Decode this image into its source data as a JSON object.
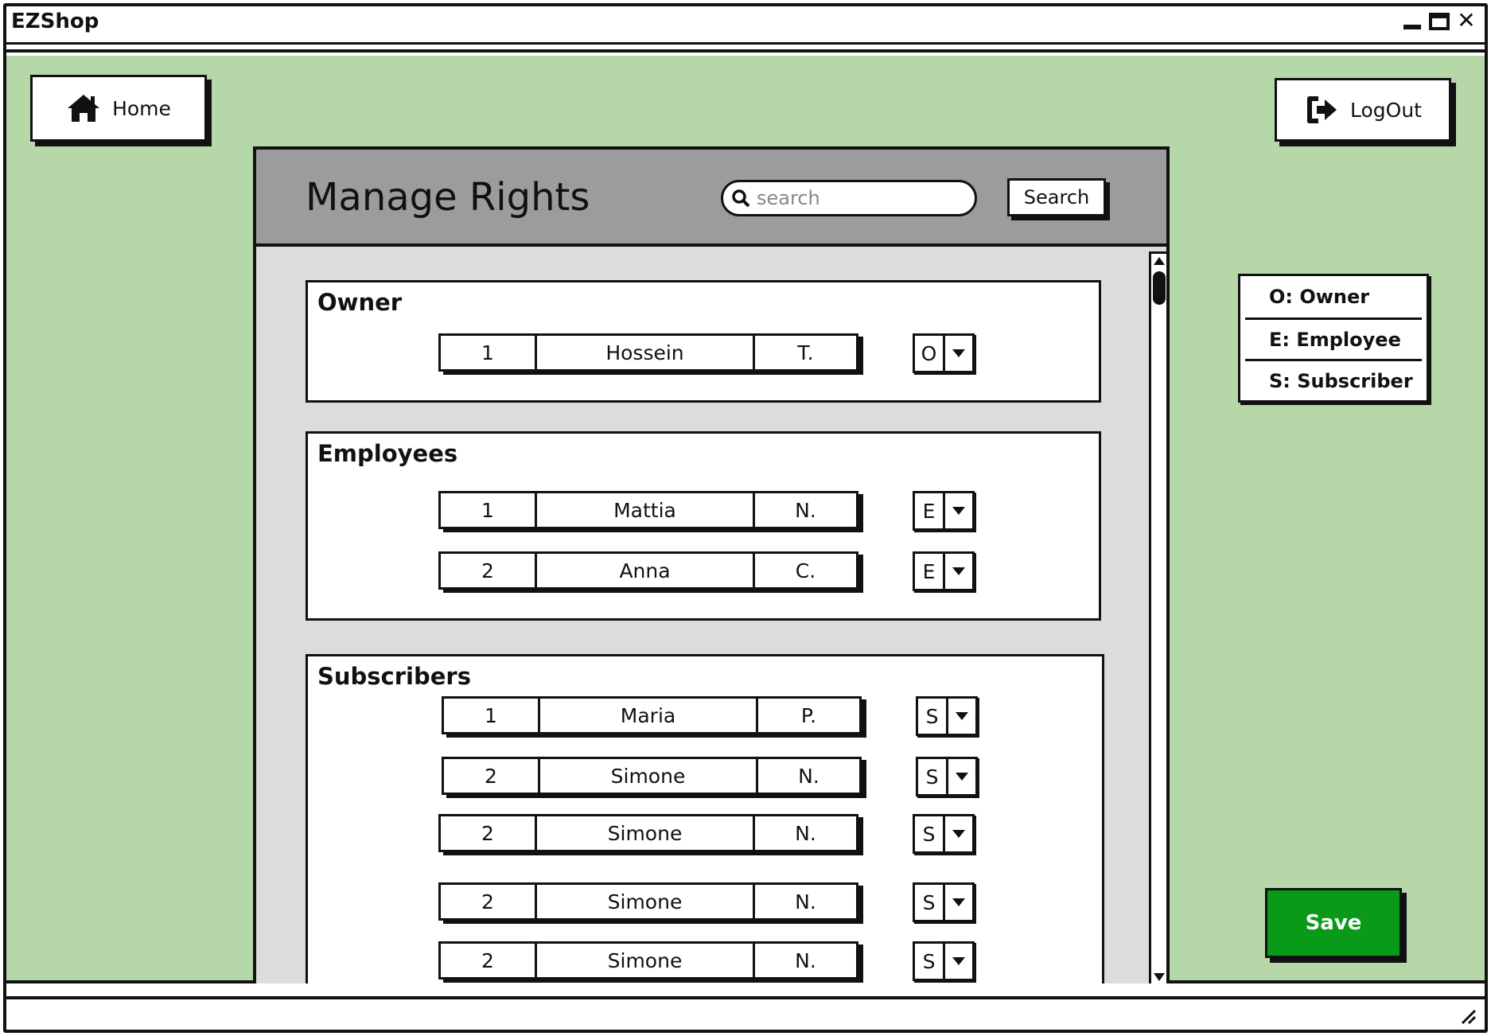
{
  "window": {
    "title": "EZShop"
  },
  "nav": {
    "home_label": "Home",
    "logout_label": "LogOut"
  },
  "panel": {
    "title": "Manage Rights",
    "search_placeholder": "search",
    "search_button": "Search"
  },
  "legend": [
    {
      "label": "O: Owner"
    },
    {
      "label": "E: Employee"
    },
    {
      "label": "S: Subscriber"
    }
  ],
  "groups": {
    "owner": {
      "title": "Owner",
      "rows": [
        {
          "id": "1",
          "name": "Hossein",
          "initial": "T.",
          "role": "O"
        }
      ]
    },
    "employees": {
      "title": "Employees",
      "rows": [
        {
          "id": "1",
          "name": "Mattia",
          "initial": "N.",
          "role": "E"
        },
        {
          "id": "2",
          "name": "Anna",
          "initial": "C.",
          "role": "E"
        }
      ]
    },
    "subscribers": {
      "title": "Subscribers",
      "rows": [
        {
          "id": "1",
          "name": "Maria",
          "initial": "P.",
          "role": "S"
        },
        {
          "id": "2",
          "name": "Simone",
          "initial": "N.",
          "role": "S"
        },
        {
          "id": "2",
          "name": "Simone",
          "initial": "N.",
          "role": "S"
        },
        {
          "id": "2",
          "name": "Simone",
          "initial": "N.",
          "role": "S"
        },
        {
          "id": "2",
          "name": "Simone",
          "initial": "N.",
          "role": "S"
        }
      ]
    }
  },
  "actions": {
    "save_label": "Save"
  },
  "colors": {
    "background": "#b6d7a8",
    "save": "#0a9a1a",
    "header": "#9c9c9c",
    "panel": "#dcdcdc"
  }
}
